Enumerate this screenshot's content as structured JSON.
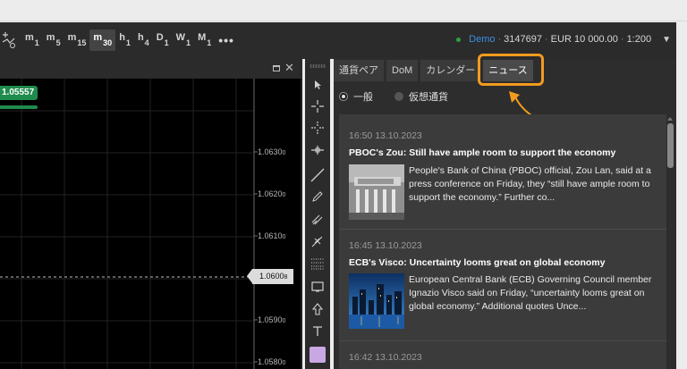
{
  "timeframes": [
    {
      "letter": "m",
      "num": "1"
    },
    {
      "letter": "m",
      "num": "5"
    },
    {
      "letter": "m",
      "num": "15"
    },
    {
      "letter": "m",
      "num": "30",
      "active": true
    },
    {
      "letter": "h",
      "num": "1"
    },
    {
      "letter": "h",
      "num": "4"
    },
    {
      "letter": "D",
      "num": "1"
    },
    {
      "letter": "W",
      "num": "1"
    },
    {
      "letter": "M",
      "num": "1"
    }
  ],
  "more_label": "•••",
  "account": {
    "mode": "Demo",
    "sep1": "·",
    "number": "3147697",
    "sep2": "·",
    "balance": "EUR 10 000.00",
    "sep3": "·",
    "leverage": "1:200",
    "status_color": "#2ea043"
  },
  "chart": {
    "badge_price": "1.05557",
    "axis_labels": [
      {
        "main": "1.0630",
        "small": "0"
      },
      {
        "main": "1.0620",
        "small": "0"
      },
      {
        "main": "1.0610",
        "small": "0"
      },
      {
        "main": "1.0590",
        "small": "0"
      },
      {
        "main": "1.0580",
        "small": "0"
      }
    ],
    "current_price": {
      "main": "1.0600",
      "small": "8"
    }
  },
  "panel": {
    "tabs": [
      {
        "label": "通貨ペア"
      },
      {
        "label": "DoM"
      },
      {
        "label": "カレンダー"
      },
      {
        "label": "ニュース",
        "active": true
      }
    ],
    "filters": [
      {
        "label": "一般",
        "selected": true
      },
      {
        "label": "仮想通貨",
        "selected": false
      }
    ],
    "news": [
      {
        "time": "16:50 13.10.2023",
        "title": "PBOC's Zou: Still have ample room to support the economy",
        "body": "People's Bank of China (PBOC) official, Zou Lan, said at a press conference on Friday, they “still have ample room to support the economy.” Further co..."
      },
      {
        "time": "16:45 13.10.2023",
        "title": "ECB's Visco: Uncertainty looms great on global economy",
        "body": "European Central Bank (ECB) Governing Council member Ignazio Visco said on Friday, “uncertainty looms great on global economy.” Additional quotes Unce..."
      },
      {
        "time": "16:42 13.10.2023"
      }
    ],
    "highlight_color": "#f29b1e"
  }
}
